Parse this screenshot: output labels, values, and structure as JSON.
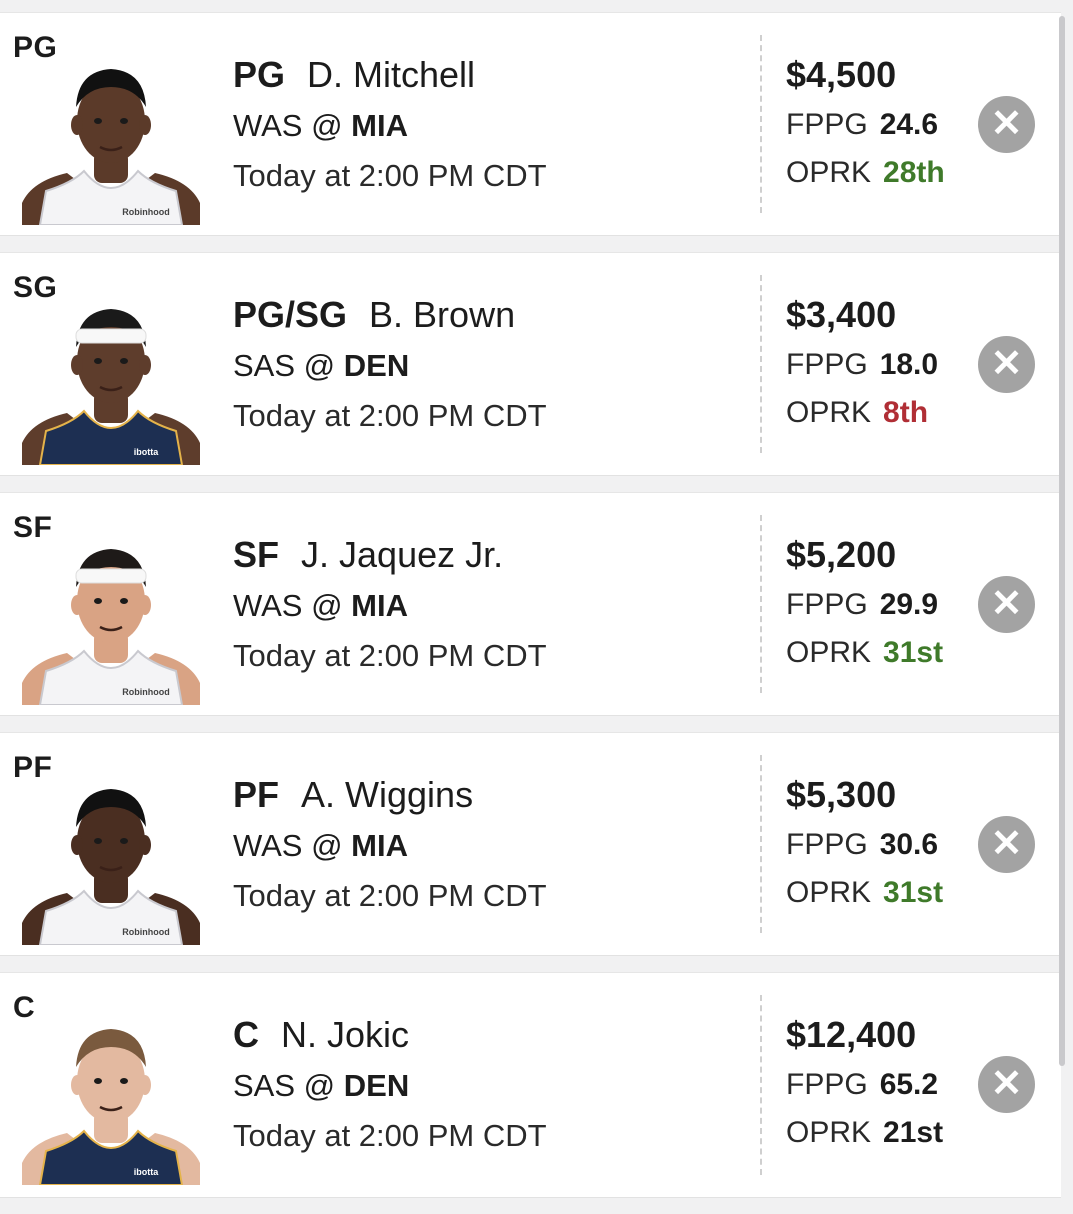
{
  "players": [
    {
      "slot": "PG",
      "pos": "PG",
      "name": "D. Mitchell",
      "away": "WAS @",
      "home": "MIA",
      "time": "Today at 2:00 PM CDT",
      "salary": "$4,500",
      "fppg_label": "FPPG",
      "fppg": "24.6",
      "oprk_label": "OPRK",
      "oprk": "28th",
      "oprk_color": "#3f7a2a",
      "remove": "✕",
      "jersey_color": "#f4f4f6",
      "skin": "#5b3a29",
      "hair": "#111111",
      "jersey_text": "Robinhood",
      "headband": false
    },
    {
      "slot": "SG",
      "pos": "PG/SG",
      "name": "B. Brown",
      "away": "SAS @",
      "home": "DEN",
      "time": "Today at 2:00 PM CDT",
      "salary": "$3,400",
      "fppg_label": "FPPG",
      "fppg": "18.0",
      "oprk_label": "OPRK",
      "oprk": "8th",
      "oprk_color": "#b02e35",
      "remove": "✕",
      "jersey_color": "#1d2f52",
      "skin": "#5e3d2c",
      "hair": "#1a1a1a",
      "jersey_text": "ibotta",
      "headband": true
    },
    {
      "slot": "SF",
      "pos": "SF",
      "name": "J. Jaquez Jr.",
      "away": "WAS @",
      "home": "MIA",
      "time": "Today at 2:00 PM CDT",
      "salary": "$5,200",
      "fppg_label": "FPPG",
      "fppg": "29.9",
      "oprk_label": "OPRK",
      "oprk": "31st",
      "oprk_color": "#3f7a2a",
      "remove": "✕",
      "jersey_color": "#f4f4f6",
      "skin": "#d9a384",
      "hair": "#1e1a18",
      "jersey_text": "Robinhood",
      "headband": true
    },
    {
      "slot": "PF",
      "pos": "PF",
      "name": "A. Wiggins",
      "away": "WAS @",
      "home": "MIA",
      "time": "Today at 2:00 PM CDT",
      "salary": "$5,300",
      "fppg_label": "FPPG",
      "fppg": "30.6",
      "oprk_label": "OPRK",
      "oprk": "31st",
      "oprk_color": "#3f7a2a",
      "remove": "✕",
      "jersey_color": "#f4f4f6",
      "skin": "#4a2e21",
      "hair": "#111111",
      "jersey_text": "Robinhood",
      "headband": false
    },
    {
      "slot": "C",
      "pos": "C",
      "name": "N. Jokic",
      "away": "SAS @",
      "home": "DEN",
      "time": "Today at 2:00 PM CDT",
      "salary": "$12,400",
      "fppg_label": "FPPG",
      "fppg": "65.2",
      "oprk_label": "OPRK",
      "oprk": "21st",
      "oprk_color": "#1c1c1c",
      "remove": "✕",
      "jersey_color": "#1d2f52",
      "skin": "#e3b9a0",
      "hair": "#7a5a3e",
      "jersey_text": "ibotta",
      "headband": false
    }
  ]
}
